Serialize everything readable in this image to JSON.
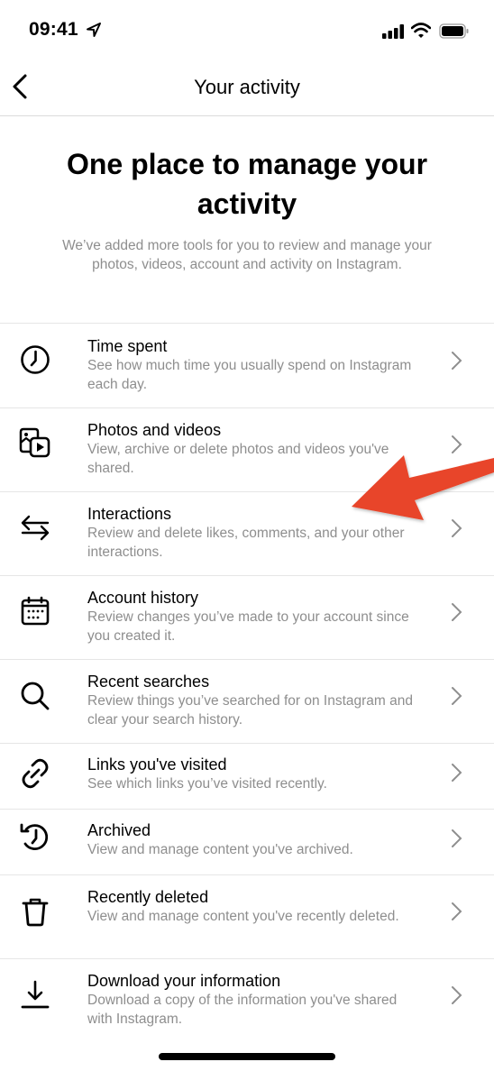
{
  "status_bar": {
    "time": "09:41",
    "icons": [
      "location-arrow-icon",
      "signal-icon",
      "wifi-icon",
      "battery-icon"
    ]
  },
  "nav": {
    "back_icon": "chevron-left-icon",
    "title": "Your activity"
  },
  "hero": {
    "title": "One place to manage your activity",
    "subtitle": "We’ve added more tools for you to review and manage your photos, videos, account and activity on Instagram."
  },
  "items": [
    {
      "icon": "clock-icon",
      "title": "Time spent",
      "description": "See how much time you usually spend on Instagram each day."
    },
    {
      "icon": "photos-videos-icon",
      "title": "Photos and videos",
      "description": "View, archive or delete photos and videos you've shared."
    },
    {
      "icon": "interactions-arrows-icon",
      "title": "Interactions",
      "description": "Review and delete likes, comments, and your other interactions."
    },
    {
      "icon": "calendar-icon",
      "title": "Account history",
      "description": "Review changes you’ve made to your account since you created it."
    },
    {
      "icon": "search-icon",
      "title": "Recent searches",
      "description": "Review things you’ve searched for on Instagram and clear your search history."
    },
    {
      "icon": "link-icon",
      "title": "Links you've visited",
      "description": "See which links you’ve visited recently."
    },
    {
      "icon": "archive-history-icon",
      "title": "Archived",
      "description": "View and manage content you've archived."
    },
    {
      "icon": "trash-icon",
      "title": "Recently deleted",
      "description": "View and manage content you've recently deleted."
    },
    {
      "icon": "download-icon",
      "title": "Download your information",
      "description": "Download a copy of the information you've shared with Instagram."
    }
  ],
  "annotation": {
    "type": "red-arrow",
    "color": "#e8452a",
    "points_to": "Interactions"
  }
}
